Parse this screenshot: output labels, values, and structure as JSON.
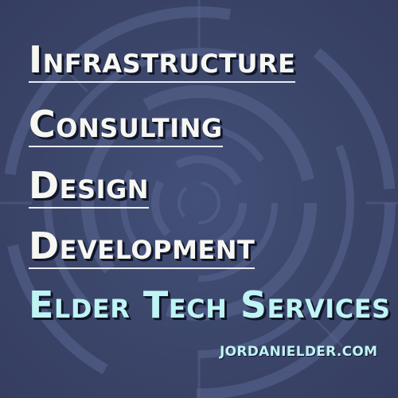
{
  "lines": {
    "infrastructure": "Infrastructure",
    "consulting": "Consulting",
    "design": "Design",
    "development": "Development"
  },
  "brand": "Elder Tech Services",
  "website": "JORDANIELDER.COM",
  "colors": {
    "background": "#3a4468",
    "heading_text": "#f6f6f2",
    "brand_text": "#bff4f4",
    "shadow": "#111628"
  }
}
